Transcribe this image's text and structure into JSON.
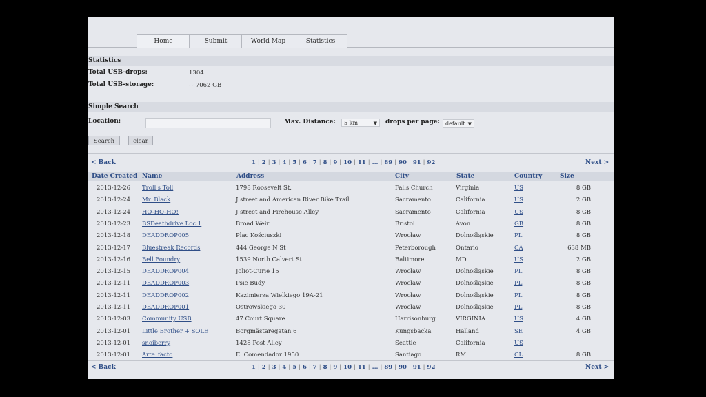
{
  "nav": {
    "tabs": [
      {
        "label": "Home"
      },
      {
        "label": "Submit"
      },
      {
        "label": "World Map"
      },
      {
        "label": "Statistics"
      }
    ]
  },
  "statistics": {
    "heading": "Statistics",
    "drops_label": "Total USB-drops:",
    "drops_value": "1304",
    "storage_label": "Total USB-storage:",
    "storage_value": "~ 7062 GB"
  },
  "search": {
    "heading": "Simple Search",
    "location_label": "Location:",
    "location_value": "",
    "distance_label": "Max. Distance:",
    "distance_value": "5 km",
    "perpage_label": "drops per page:",
    "perpage_value": "default",
    "search_button": "Search",
    "clear_button": "clear"
  },
  "pagination": {
    "back": "< Back",
    "next": "Next >",
    "pages": [
      "1",
      "2",
      "3",
      "4",
      "5",
      "6",
      "7",
      "8",
      "9",
      "10",
      "11",
      "...",
      "89",
      "90",
      "91",
      "92"
    ]
  },
  "table": {
    "headers": [
      "Date Created",
      "Name",
      "Address",
      "City",
      "State",
      "Country",
      "Size"
    ],
    "rows": [
      [
        "2013-12-26",
        "Troll's Toll",
        "1798 Roosevelt St.",
        "Falls Church",
        "Virginia",
        "US",
        "8 GB"
      ],
      [
        "2013-12-24",
        "Mr. Black",
        "J street and American River Bike Trail",
        "Sacramento",
        "California",
        "US",
        "2 GB"
      ],
      [
        "2013-12-24",
        "HO-HO-HO!",
        "J street and Firehouse Alley",
        "Sacramento",
        "California",
        "US",
        "8 GB"
      ],
      [
        "2013-12-23",
        "BSDeathdrive Loc.1",
        "Broad Weir",
        "Bristol",
        "Avon",
        "GB",
        "8 GB"
      ],
      [
        "2013-12-18",
        "DEADDROP005",
        "Plac Kościuszki",
        "Wrocław",
        "Dolnośląskie",
        "PL",
        "8 GB"
      ],
      [
        "2013-12-17",
        "Bluestreak Records",
        "444 George N St",
        "Peterborough",
        "Ontario",
        "CA",
        "638 MB"
      ],
      [
        "2013-12-16",
        "Bell Foundry",
        "1539 North Calvert St",
        "Baltimore",
        "MD",
        "US",
        "2 GB"
      ],
      [
        "2013-12-15",
        "DEADDROP004",
        "Joliot-Curie 15",
        "Wrocław",
        "Dolnośląskie",
        "PL",
        "8 GB"
      ],
      [
        "2013-12-11",
        "DEADDROP003",
        "Psie Budy",
        "Wrocław",
        "Dolnośląskie",
        "PL",
        "8 GB"
      ],
      [
        "2013-12-11",
        "DEADDROP002",
        "Kazimierza Wielkiego 19A-21",
        "Wrocław",
        "Dolnośląskie",
        "PL",
        "8 GB"
      ],
      [
        "2013-12-11",
        "DEADDROP001",
        "Ostrowskiego 30",
        "Wrocław",
        "Dolnośląskie",
        "PL",
        "8 GB"
      ],
      [
        "2013-12-03",
        "Community USB",
        "47 Court Square",
        "Harrisonburg",
        "VIRGINIA",
        "US",
        "4 GB"
      ],
      [
        "2013-12-01",
        "Little Brother + SOLE",
        "Borgmästaregatan 6",
        "Kungsbacka",
        "Halland",
        "SE",
        "4 GB"
      ],
      [
        "2013-12-01",
        "snoiberry",
        "1428 Post Alley",
        "Seattle",
        "California",
        "US",
        ""
      ],
      [
        "2013-12-01",
        "Arte_facto",
        "El Comendador 1950",
        "Santiago",
        "RM",
        "CL",
        "8 GB"
      ]
    ]
  }
}
